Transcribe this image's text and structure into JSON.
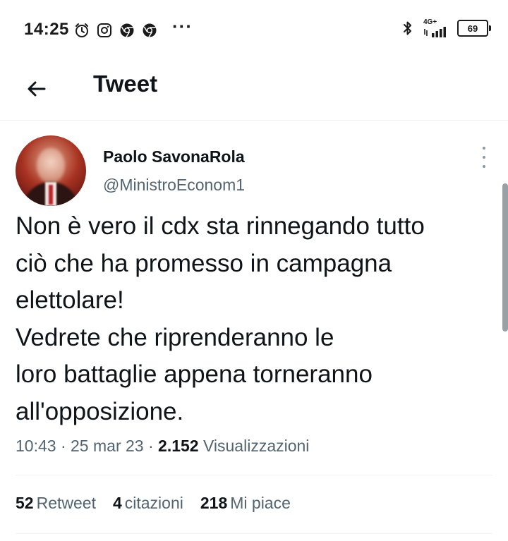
{
  "status_bar": {
    "time": "14:25",
    "notification_icons": [
      "alarm-icon",
      "instagram-icon",
      "chrome-icon",
      "chrome-icon"
    ],
    "more_label": "···",
    "network": "4G+",
    "battery": "69"
  },
  "header": {
    "back_icon": "arrow-left-icon",
    "title": "Tweet"
  },
  "tweet": {
    "author_name": "Paolo SavonaRola",
    "author_handle": "@MinistroEconom1",
    "text_lines": [
      "Non è vero il cdx sta rinnegando tutto",
      "ciò che ha promesso in campagna",
      "elettolare!",
      "Vedrete che riprenderanno le",
      "loro battaglie appena torneranno",
      "all'opposizione."
    ],
    "time": "10:43",
    "date": "25 mar 23",
    "views_count": "2.152",
    "views_label": "Visualizzazioni",
    "separator": "·"
  },
  "stats": {
    "retweets_count": "52",
    "retweets_label": "Retweet",
    "quotes_count": "4",
    "quotes_label": "citazioni",
    "likes_count": "218",
    "likes_label": "Mi piace"
  },
  "colors": {
    "text_primary": "#0f1419",
    "text_secondary": "#536471",
    "divider": "#eff3f4"
  }
}
